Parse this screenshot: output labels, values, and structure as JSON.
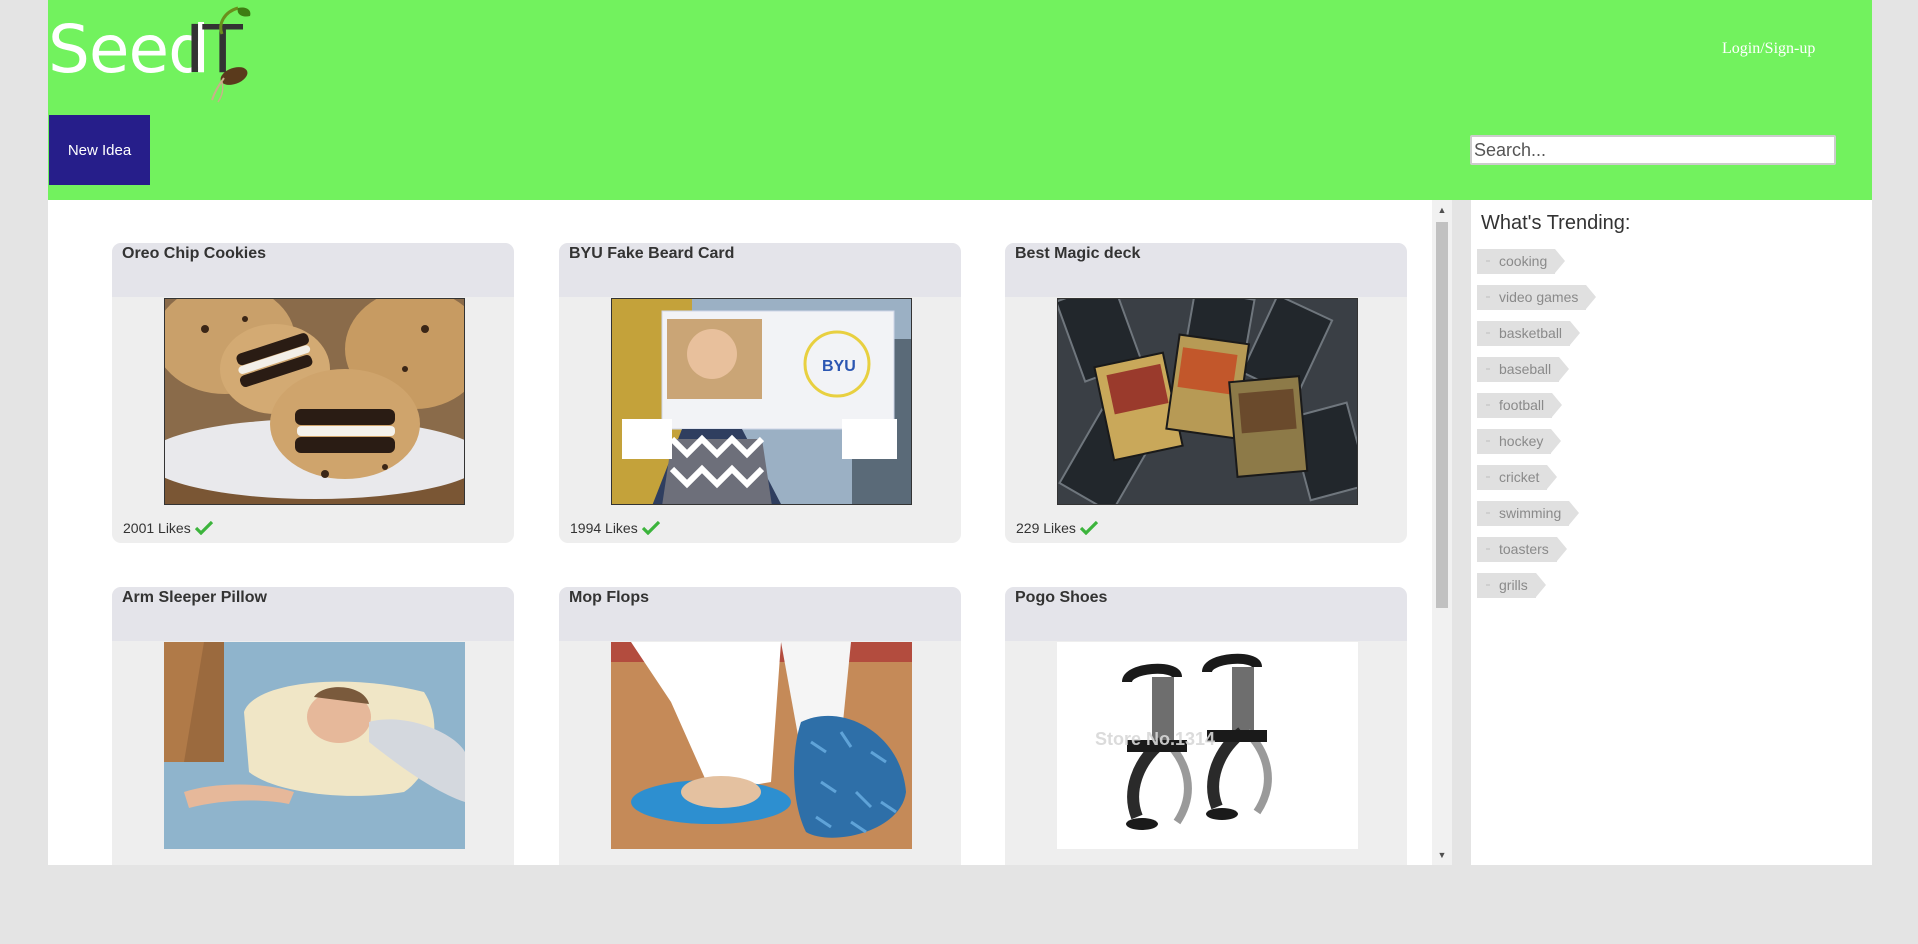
{
  "header": {
    "logo_text_seed": "Seed",
    "logo_text_it": "IT",
    "login_label": "Login/Sign-up",
    "new_idea_label": "New Idea",
    "search_placeholder": "Search...",
    "bg_color": "#72f25e",
    "button_color": "#261e8a"
  },
  "ideas": [
    {
      "title": "Oreo Chip Cookies",
      "likes": "2001 Likes",
      "image": "cookies-photo"
    },
    {
      "title": "BYU Fake Beard Card",
      "likes": "1994 Likes",
      "image": "beard-card-photo"
    },
    {
      "title": "Best Magic deck",
      "likes": "229 Likes",
      "image": "magic-cards-photo"
    },
    {
      "title": "Arm Sleeper Pillow",
      "likes": "",
      "image": "pillow-photo"
    },
    {
      "title": "Mop Flops",
      "likes": "",
      "image": "mop-slippers-photo"
    },
    {
      "title": "Pogo Shoes",
      "likes": "",
      "image": "pogo-shoes-photo"
    }
  ],
  "sidebar": {
    "title": "What's Trending:",
    "tags": [
      "cooking",
      "video games",
      "basketball",
      "baseball",
      "football",
      "hockey",
      "cricket",
      "swimming",
      "toasters",
      "grills"
    ]
  },
  "icons": {
    "like": "check-icon",
    "scroll_up": "arrow-up-icon",
    "scroll_down": "arrow-down-icon"
  }
}
